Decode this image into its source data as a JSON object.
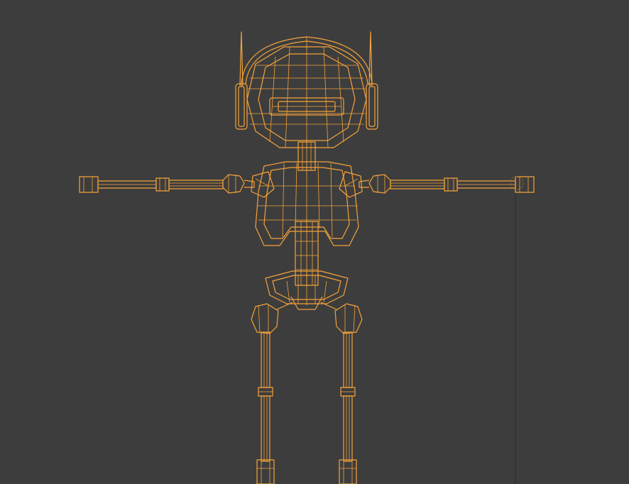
{
  "viewport": {
    "mode": "wireframe",
    "background": "#3d3d3d",
    "wire_color": "#f5a33a"
  },
  "model": {
    "name_icon": "robot-wireframe-icon"
  }
}
